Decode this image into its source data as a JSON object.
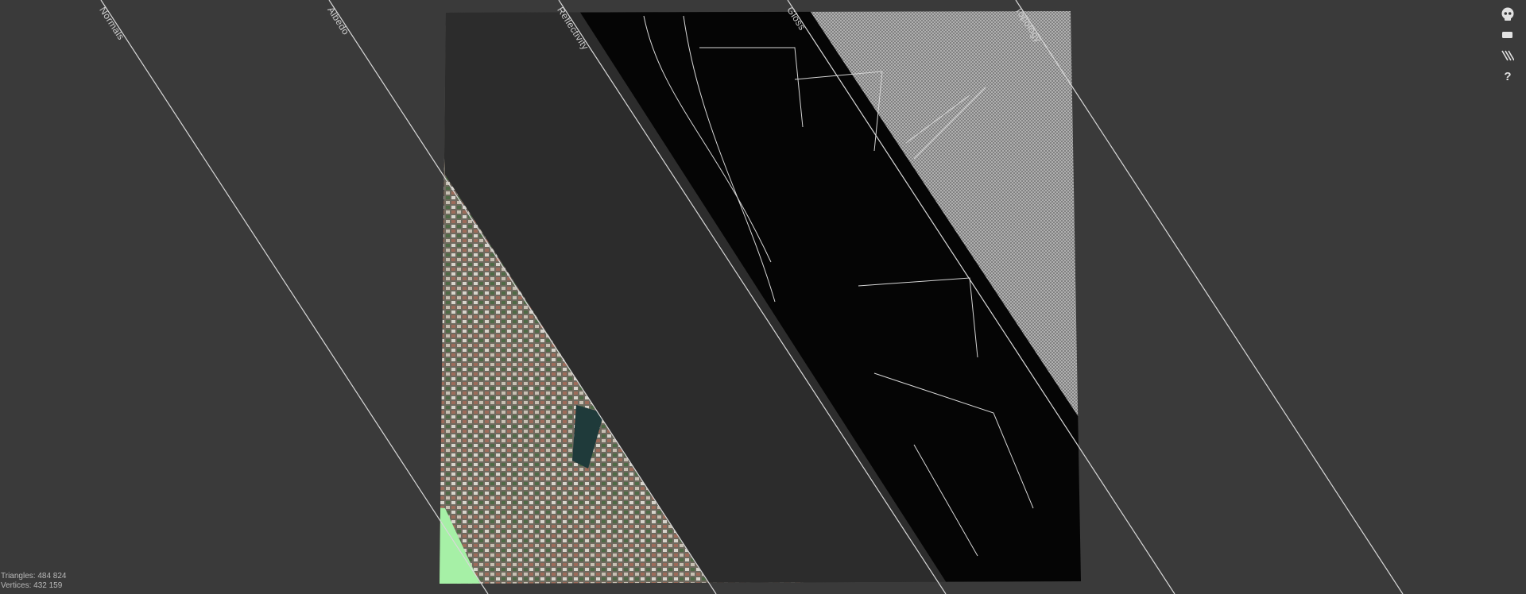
{
  "modes": [
    {
      "name": "Normals"
    },
    {
      "name": "Albedo"
    },
    {
      "name": "Reflectivity"
    },
    {
      "name": "Gloss"
    },
    {
      "name": "Topology"
    }
  ],
  "stats": {
    "triangles_label": "Triangles:",
    "triangles_value": "484 824",
    "vertices_label": "Vertices:",
    "vertices_value": "432 159"
  },
  "toolbar": [
    {
      "icon": "skull-icon"
    },
    {
      "icon": "rectangle-icon"
    },
    {
      "icon": "stripes-icon"
    },
    {
      "icon": "help-icon",
      "glyph": "?"
    }
  ],
  "colors": {
    "background": "#3a3a3a",
    "divider": "#d8d8d8",
    "albedo_panel": "#2c2c2c",
    "reflectivity_panel": "#050505",
    "gloss_panel": "#8a8a8a",
    "normals_tint": "#a6f0a6"
  }
}
